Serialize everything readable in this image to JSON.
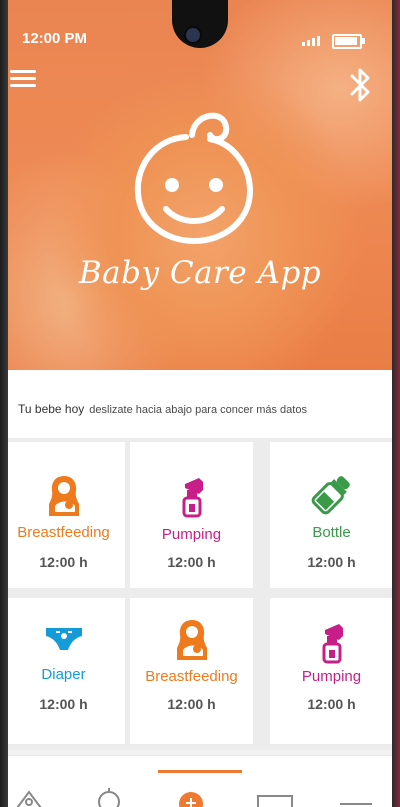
{
  "status": {
    "time": "12:00 PM"
  },
  "app": {
    "title": "Baby Care App"
  },
  "icons": {
    "menu": "hamburger-menu-icon",
    "bluetooth": "bluetooth-icon",
    "logo": "baby-face-icon"
  },
  "info": {
    "heading": "Tu bebe hoy",
    "hint": "deslizate hacia abajo para concer más datos"
  },
  "cards": [
    {
      "label": "Breastfeeding",
      "time": "12:00 h",
      "color": "#ee7a1e",
      "icon": "breastfeeding-icon"
    },
    {
      "label": "Pumping",
      "time": "12:00 h",
      "color": "#c81e8a",
      "icon": "breast-pump-icon"
    },
    {
      "label": "Bottle",
      "time": "12:00 h",
      "color": "#3a9a4a",
      "icon": "baby-bottle-icon"
    },
    {
      "label": "Diaper",
      "time": "12:00 h",
      "color": "#159bd8",
      "icon": "diaper-icon"
    },
    {
      "label": "Breastfeeding",
      "time": "12:00 h",
      "color": "#ee7a1e",
      "icon": "breastfeeding-icon"
    },
    {
      "label": "Pumping",
      "time": "12:00 h",
      "color": "#c81e8a",
      "icon": "breast-pump-icon"
    }
  ],
  "colors": {
    "accent": "#ee7a31",
    "hero_overlay": "#ee8a55"
  }
}
